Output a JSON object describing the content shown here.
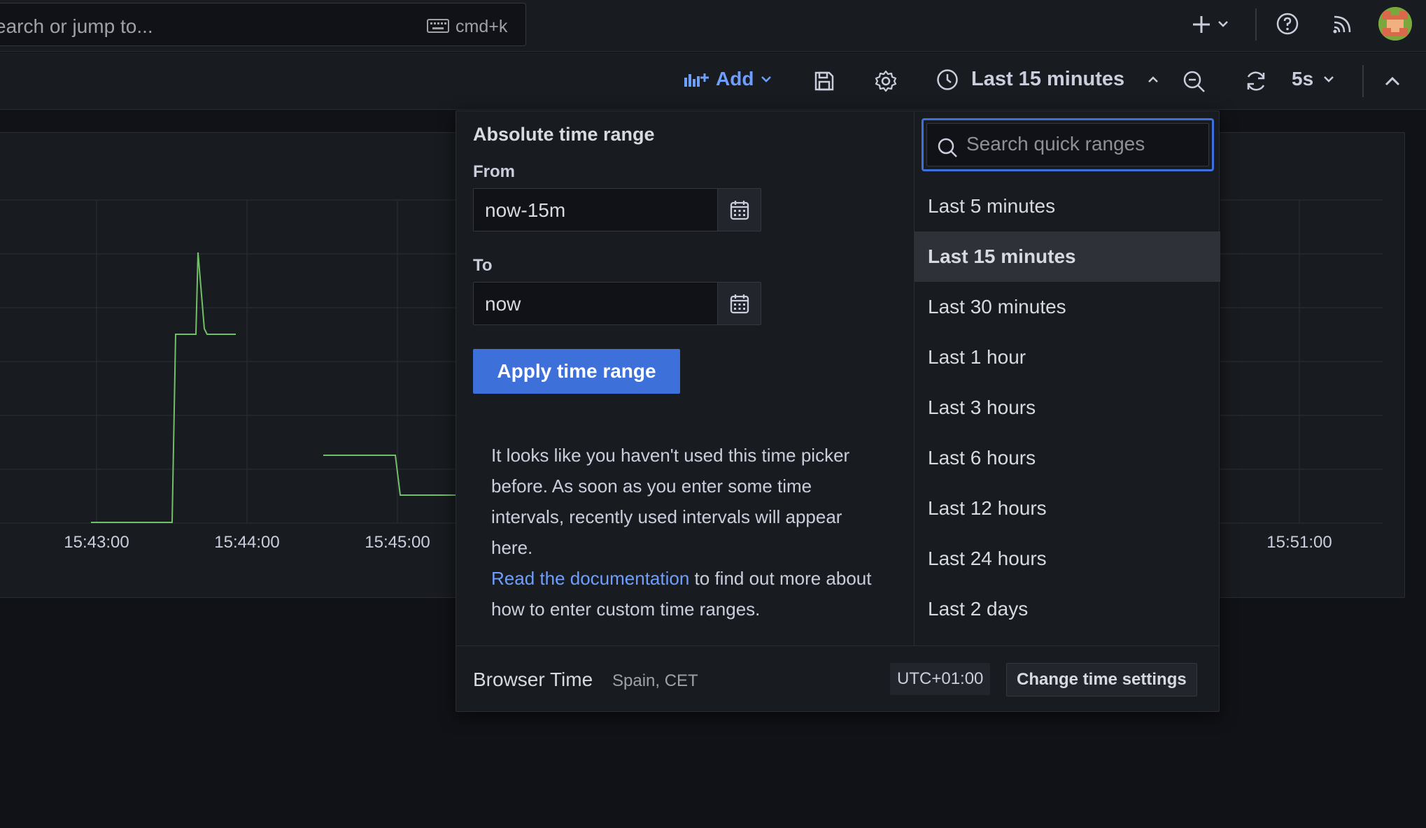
{
  "search": {
    "text": "earch or jump to...",
    "shortcut": "cmd+k"
  },
  "toolbar": {
    "add_label": "Add",
    "time_range_label": "Last 15 minutes",
    "refresh_interval": "5s"
  },
  "graph": {
    "x_tick_labels_left": [
      "15:43:00",
      "15:44:00",
      "15:45:00"
    ],
    "x_tick_labels_right": [
      "15:51:00"
    ],
    "line_color": "#73bf69"
  },
  "picker": {
    "title": "Absolute time range",
    "from_label": "From",
    "from_value": "now-15m",
    "to_label": "To",
    "to_value": "now",
    "apply_label": "Apply time range",
    "help_text": "It looks like you haven't used this time picker before. As soon as you enter some time intervals, recently used intervals will appear here.",
    "doc_link": "Read the documentation",
    "help_suffix": " to find out more about how to enter custom time ranges.",
    "search_placeholder": "Search quick ranges",
    "quick_ranges": [
      "Last 5 minutes",
      "Last 15 minutes",
      "Last 30 minutes",
      "Last 1 hour",
      "Last 3 hours",
      "Last 6 hours",
      "Last 12 hours",
      "Last 24 hours",
      "Last 2 days"
    ],
    "active_range_index": 1,
    "footer": {
      "title": "Browser Time",
      "subtitle": "Spain, CET",
      "utc": "UTC+01:00",
      "change_label": "Change time settings"
    }
  },
  "colors": {
    "accent": "#3d71d9",
    "link": "#6e9fff",
    "background": "#111217",
    "panel": "#181b1f"
  }
}
